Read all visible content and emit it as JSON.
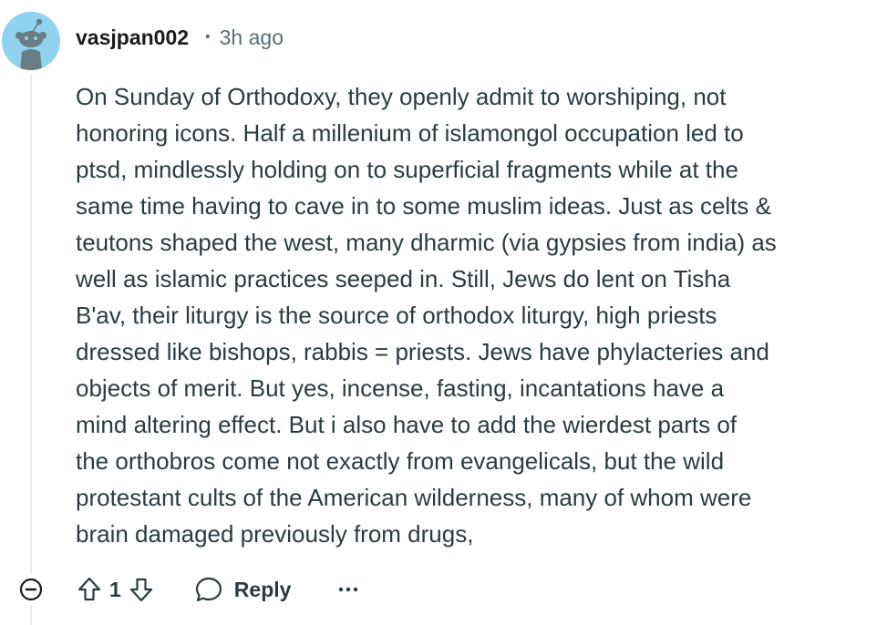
{
  "comment": {
    "username": "vasjpan002",
    "separator": "•",
    "timestamp": "3h ago",
    "body_lines": [
      "On Sunday of Orthodoxy, they openly admit to worshiping, not",
      "honoring icons. Half a millenium of islamongol occupation led to",
      "ptsd, mindlessly holding on to superficial fragments while at the",
      "same time having to cave in to some muslim ideas. Just as celts &",
      "teutons shaped the west, many dharmic (via gypsies from india) as",
      "well as islamic practices seeped in. Still, Jews do lent on Tisha",
      "B'av, their liturgy is the source of orthodox liturgy, high priests",
      "dressed like bishops, rabbis = priests. Jews have phylacteries and",
      "objects of merit. But yes, incense, fasting, incantations have a",
      "mind altering effect. But i also have to add the wierdest parts of",
      "the orthobros come not exactly from evangelicals, but the wild",
      "protestant cults of the American wilderness, many of whom were",
      "brain damaged previously from drugs,"
    ]
  },
  "actions": {
    "vote_count": "1",
    "reply_label": "Reply"
  },
  "icons": {
    "avatar": "snoo-avatar-icon",
    "collapse": "minus-circle-icon",
    "upvote": "arrow-up-icon",
    "downvote": "arrow-down-icon",
    "reply": "speech-bubble-icon",
    "more": "ellipsis-icon"
  },
  "colors": {
    "avatar_bg": "#8fd3ee",
    "text": "#2a3c42",
    "meta": "#576f76",
    "thread_line": "#e5ebee"
  }
}
